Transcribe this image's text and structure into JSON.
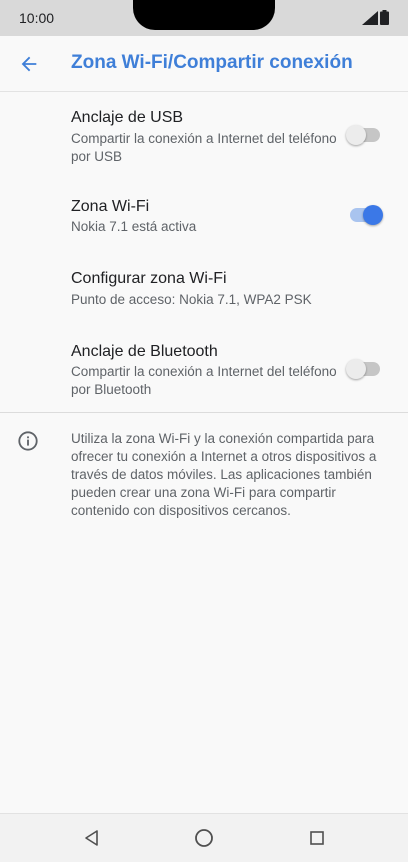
{
  "status_bar": {
    "time": "10:00"
  },
  "app_bar": {
    "title": "Zona Wi-Fi/Compartir conexión"
  },
  "settings": [
    {
      "title": "Anclaje de USB",
      "summary": "Compartir la conexión a Internet del teléfono por USB",
      "toggle": "off"
    },
    {
      "title": "Zona Wi-Fi",
      "summary": "Nokia 7.1 está activa",
      "toggle": "on"
    },
    {
      "title": "Configurar zona Wi-Fi",
      "summary": "Punto de acceso: Nokia 7.1, WPA2 PSK"
    },
    {
      "title": "Anclaje de Bluetooth",
      "summary": "Compartir la conexión a Internet del teléfono por Bluetooth",
      "toggle": "off"
    }
  ],
  "info": {
    "text": "Utiliza la zona Wi-Fi y la conexión compartida para ofrecer tu conexión a Internet a otros dispositivos a través de datos móviles. Las aplicaciones también pueden crear una zona Wi-Fi para compartir contenido con dispositivos cercanos."
  },
  "colors": {
    "accent": "#3f7fd8",
    "toggle_on": "#3b78e7",
    "status_bar": "#d9d9d9",
    "background": "#f9f9f9"
  },
  "icons": {
    "back": "arrow-left-icon",
    "info": "info-circle-icon",
    "nav": [
      "back-triangle-icon",
      "home-circle-icon",
      "recents-square-icon"
    ]
  }
}
